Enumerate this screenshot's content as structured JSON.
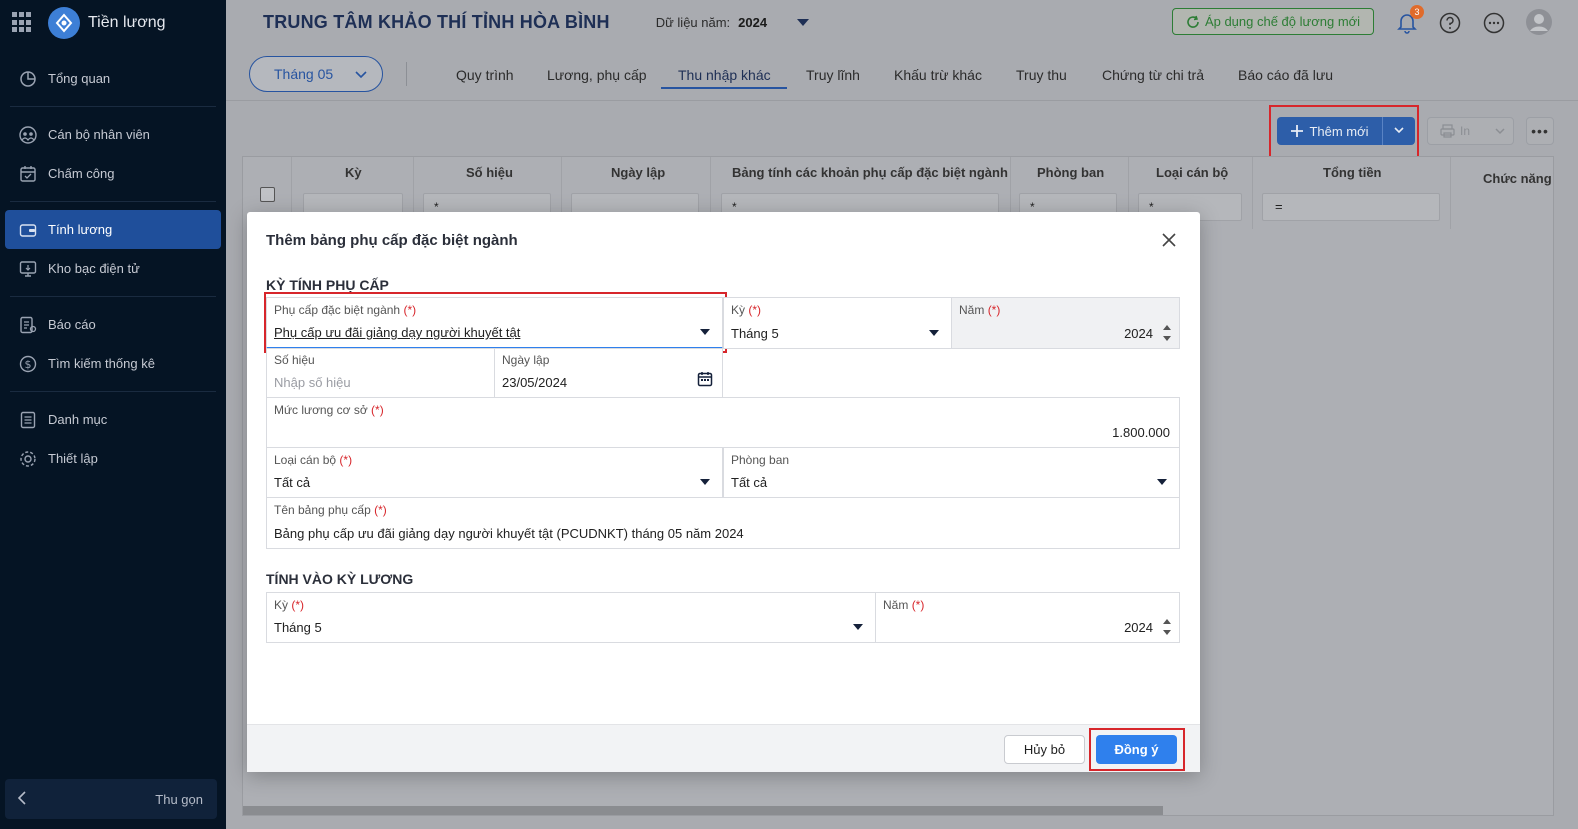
{
  "app": {
    "name": "Tiền lương"
  },
  "header": {
    "org_title": "TRUNG TÂM KHẢO THÍ TỈNH HÒA BÌNH",
    "year_label": "Dữ liệu năm:",
    "year_value": "2024",
    "apply_button": "Áp dụng chế độ lương mới",
    "notification_count": "3"
  },
  "sidebar": {
    "items": [
      {
        "label": "Tổng quan",
        "icon": "dashboard-icon"
      },
      {
        "label": "Cán bộ nhân viên",
        "icon": "staff-icon"
      },
      {
        "label": "Chấm công",
        "icon": "calendar-icon"
      },
      {
        "label": "Tính lương",
        "icon": "wallet-icon",
        "active": true
      },
      {
        "label": "Kho bạc điện tử",
        "icon": "monitor-icon"
      },
      {
        "label": "Báo cáo",
        "icon": "report-icon"
      },
      {
        "label": "Tìm kiếm thống kê",
        "icon": "dollar-search-icon"
      },
      {
        "label": "Danh mục",
        "icon": "list-icon"
      },
      {
        "label": "Thiết lập",
        "icon": "gear-icon"
      }
    ],
    "collapse_label": "Thu gọn"
  },
  "tabs": {
    "month_selector": "Tháng 05",
    "items": [
      "Quy trình",
      "Lương, phụ cấp",
      "Thu nhập khác",
      "Truy lĩnh",
      "Khấu trừ khác",
      "Truy thu",
      "Chứng từ chi trả",
      "Báo cáo đã lưu"
    ],
    "active_index": 2
  },
  "toolbar": {
    "add_new": "Thêm mới",
    "print": "In"
  },
  "table": {
    "columns": [
      "Kỳ",
      "Số hiệu",
      "Ngày lập",
      "Bảng tính các khoản phụ cấp đặc biệt ngành",
      "Phòng ban",
      "Loại cán bộ",
      "Tổng tiền",
      "Chức năng"
    ],
    "filter_ops": [
      "*",
      "*",
      "*",
      "*",
      "*",
      "="
    ]
  },
  "modal": {
    "title": "Thêm bảng phụ cấp đặc biệt ngành",
    "section1_title": "KỲ TÍNH PHỤ CẤP",
    "required_mark": "(*)",
    "allowance_label": "Phụ cấp đặc biệt ngành",
    "allowance_value": "Phụ cấp ưu đãi giảng dạy người khuyết tật",
    "period_label": "Kỳ",
    "period_value": "Tháng 5",
    "year_label": "Năm",
    "year_value": "2024",
    "number_label": "Số hiệu",
    "number_placeholder": "Nhập số hiệu",
    "date_label": "Ngày lập",
    "date_value": "23/05/2024",
    "base_salary_label": "Mức lương cơ sở",
    "base_salary_value": "1.800.000",
    "staff_type_label": "Loại cán bộ",
    "staff_type_value": "Tất cả",
    "department_label": "Phòng ban",
    "department_value": "Tất cả",
    "sheet_name_label": "Tên bảng phụ cấp",
    "sheet_name_value": "Bảng phụ cấp ưu đãi giảng dạy người khuyết tật (PCUDNKT) tháng 05 năm 2024",
    "section2_title": "TÍNH VÀO KỲ LƯƠNG",
    "pay_period_label": "Kỳ",
    "pay_period_value": "Tháng 5",
    "pay_year_label": "Năm",
    "pay_year_value": "2024",
    "cancel": "Hủy bỏ",
    "confirm": "Đồng ý"
  }
}
